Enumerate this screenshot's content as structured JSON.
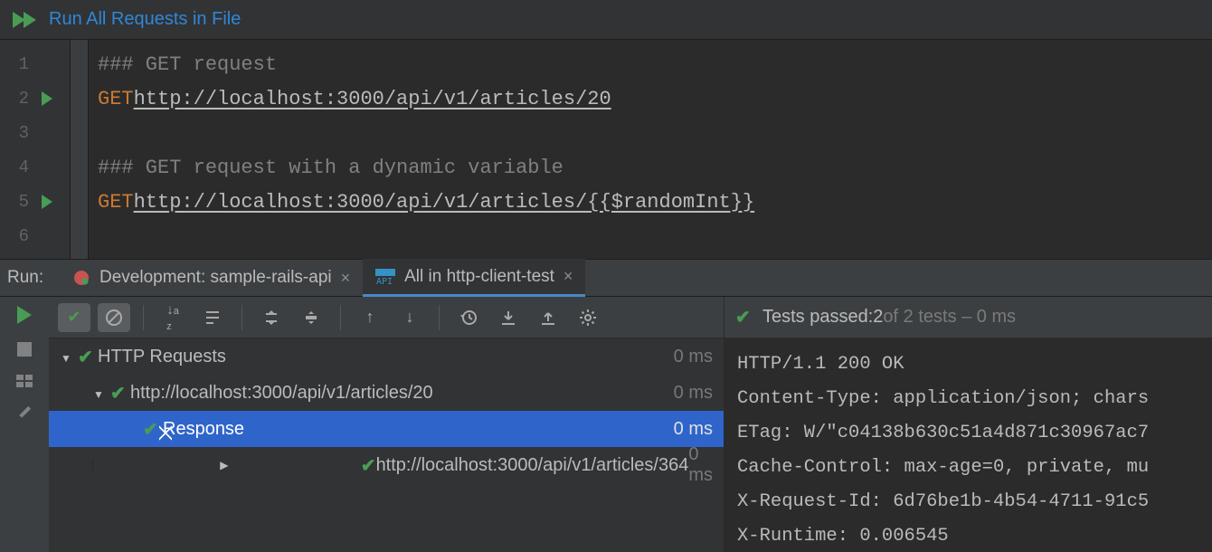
{
  "runbar": {
    "label": "Run All Requests in File"
  },
  "editor": {
    "lines": [
      {
        "n": "1",
        "play": false,
        "tokens": [
          {
            "cls": "cmt",
            "t": "### GET request"
          }
        ]
      },
      {
        "n": "2",
        "play": true,
        "tokens": [
          {
            "cls": "kw",
            "t": "GET"
          },
          {
            "cls": "",
            "t": " "
          },
          {
            "cls": "url",
            "t": "http://localhost:3000/api/v1/articles/20"
          }
        ]
      },
      {
        "n": "3",
        "play": false,
        "tokens": []
      },
      {
        "n": "4",
        "play": false,
        "tokens": [
          {
            "cls": "cmt",
            "t": "### GET request with a dynamic variable"
          }
        ]
      },
      {
        "n": "5",
        "play": true,
        "tokens": [
          {
            "cls": "kw",
            "t": "GET"
          },
          {
            "cls": "",
            "t": " "
          },
          {
            "cls": "url",
            "t": "http://localhost:3000/api/v1/articles/{{$randomInt}}"
          }
        ]
      },
      {
        "n": "6",
        "play": false,
        "tokens": []
      }
    ]
  },
  "runhdr": {
    "label": "Run:",
    "tabs": [
      {
        "label": "Development: sample-rails-api",
        "active": false,
        "kind": "rails"
      },
      {
        "label": "All in http-client-test",
        "active": true,
        "kind": "api"
      }
    ]
  },
  "status": {
    "prefix": "Tests passed: ",
    "passed": "2",
    "suffix": " of 2 tests – 0 ms"
  },
  "tree": [
    {
      "depth": 0,
      "arrow": "down",
      "ok": true,
      "label": "HTTP Requests",
      "dur": "0 ms",
      "selected": false
    },
    {
      "depth": 1,
      "arrow": "down",
      "ok": true,
      "label": "http://localhost:3000/api/v1/articles/20",
      "dur": "0 ms",
      "selected": false
    },
    {
      "depth": 2,
      "arrow": "",
      "ok": true,
      "label": "Response",
      "dur": "0 ms",
      "selected": true,
      "cursor": true
    },
    {
      "depth": 1,
      "arrow": "right",
      "ok": true,
      "label": "http://localhost:3000/api/v1/articles/364",
      "dur": "0 ms",
      "selected": false
    }
  ],
  "response": [
    "HTTP/1.1 200 OK",
    "Content-Type: application/json; chars",
    "ETag: W/\"c04138b630c51a4d871c30967ac7",
    "Cache-Control: max-age=0, private, mu",
    "X-Request-Id: 6d76be1b-4b54-4711-91c5",
    "X-Runtime: 0.006545"
  ],
  "toolbar_icons": [
    "check-icon",
    "disabled-icon",
    "sort-icon",
    "collapse-icon",
    "expand-all-icon",
    "collapse-all-icon",
    "prev-icon",
    "next-icon",
    "history-icon",
    "import-icon",
    "export-icon",
    "settings-icon"
  ]
}
